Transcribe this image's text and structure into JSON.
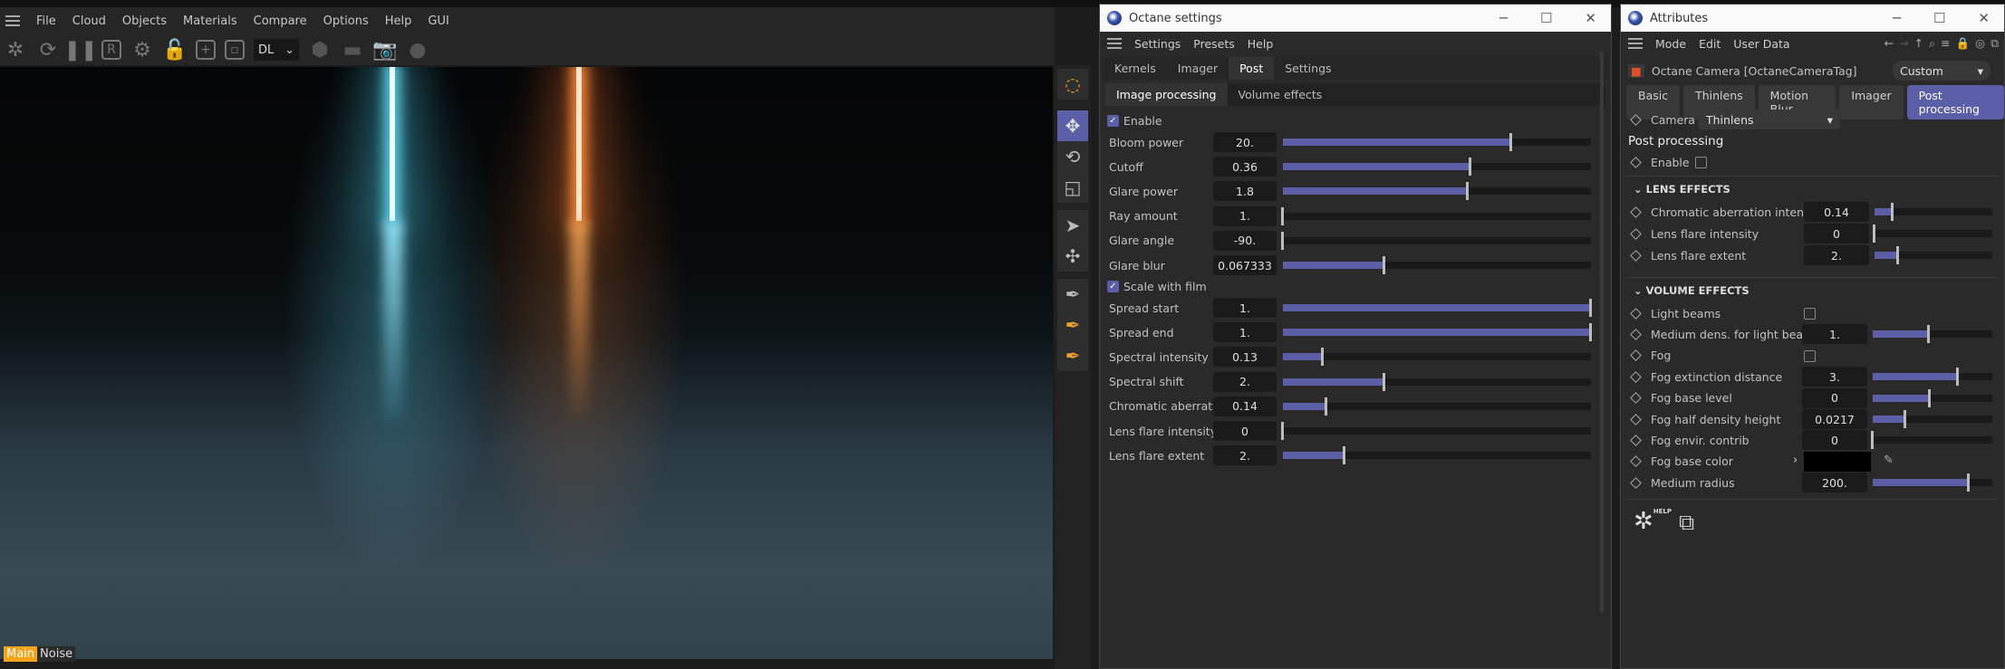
{
  "main_app": {
    "menu": [
      "File",
      "Cloud",
      "Objects",
      "Materials",
      "Compare",
      "Options",
      "Help",
      "GUI"
    ],
    "toolbar": {
      "icons": [
        "octane-logo-icon",
        "refresh-icon",
        "pause-icon",
        "render-region-icon",
        "settings-gear-icon",
        "lock-open-icon",
        "add-frame-icon",
        "frame-icon"
      ],
      "kernel_select": "DL",
      "kernel_arrow": "⌄"
    },
    "viewport_tabs": [
      "Main",
      "Noise"
    ],
    "colors": {
      "accent": "#f5a31a",
      "blue_light": "#5fd0e6",
      "orange_light": "#ff8a3a"
    }
  },
  "tool_column": {
    "icons": [
      "live-selection-icon",
      "move-icon",
      "rotate-icon",
      "scale-icon",
      "move-select-icon",
      "move-points-icon",
      "spline-pen-icon",
      "pen-point-icon",
      "pen-points-icon"
    ],
    "active": "move-icon"
  },
  "octane_settings": {
    "title": "Octane settings",
    "menu": [
      "Settings",
      "Presets",
      "Help"
    ],
    "tabs": [
      "Kernels",
      "Imager",
      "Post",
      "Settings"
    ],
    "active_tab": "Post",
    "subtabs": [
      "Image processing",
      "Volume effects"
    ],
    "active_subtab": "Image processing",
    "enable_label": "Enable",
    "enable_checked": true,
    "scale_with_film_label": "Scale with film",
    "scale_with_film_checked": true,
    "params_a": [
      {
        "label": "Bloom power",
        "value": "20.",
        "level": 0.74
      },
      {
        "label": "Cutoff",
        "value": "0.36",
        "level": 0.61
      },
      {
        "label": "Glare power",
        "value": "1.8",
        "level": 0.6
      },
      {
        "label": "Ray amount",
        "value": "1.",
        "level": 0
      },
      {
        "label": "Glare angle",
        "value": "-90.",
        "level": 0
      },
      {
        "label": "Glare blur",
        "value": "0.067333",
        "level": 0.33
      }
    ],
    "params_b": [
      {
        "label": "Spread start",
        "value": "1.",
        "level": 1
      },
      {
        "label": "Spread end",
        "value": "1.",
        "level": 1
      },
      {
        "label": "Spectral intensity",
        "value": "0.13",
        "level": 0.13
      },
      {
        "label": "Spectral shift",
        "value": "2.",
        "level": 0.33
      },
      {
        "label": "Chromatic aberrati...",
        "value": "0.14",
        "level": 0.14
      },
      {
        "label": "Lens flare intensity",
        "value": "0",
        "level": 0
      },
      {
        "label": "Lens flare extent",
        "value": "2.",
        "level": 0.2
      }
    ]
  },
  "attributes": {
    "title": "Attributes",
    "menu": [
      "Mode",
      "Edit",
      "User Data"
    ],
    "nav_icons": [
      "back-arrow-icon",
      "forward-arrow-icon",
      "up-arrow-icon",
      "search-icon",
      "filter-icon",
      "lock-icon",
      "target-icon",
      "new-window-icon"
    ],
    "object_name": "Octane Camera [OctaneCameraTag]",
    "preset": "Custom",
    "tabs": [
      "Basic",
      "Thinlens",
      "Motion Blur",
      "Imager",
      "Post processing"
    ],
    "active_tab": "Post processing",
    "camera_type_label": "Camera type",
    "camera_type": "Thinlens",
    "section_title": "Post processing",
    "enable_label": "Enable",
    "enable_checked": false,
    "lens_effects_title": "LENS EFFECTS",
    "lens_effects": [
      {
        "label": "Chromatic aberration intensity",
        "value": "0.14",
        "level": 0.15
      },
      {
        "label": "Lens flare intensity",
        "value": "0",
        "level": 0
      },
      {
        "label": "Lens flare extent",
        "value": "2.",
        "level": 0.2
      }
    ],
    "volume_effects_title": "VOLUME EFFECTS",
    "volume_effects": [
      {
        "label": "Light beams",
        "type": "checkbox",
        "checked": false
      },
      {
        "label": "Medium dens. for light beams",
        "value": "1.",
        "level": 0.47
      },
      {
        "label": "Fog",
        "type": "checkbox",
        "checked": false
      },
      {
        "label": "Fog extinction distance",
        "value": "3.",
        "level": 0.71
      },
      {
        "label": "Fog base level",
        "value": "0",
        "level": 0.48
      },
      {
        "label": "Fog half density height",
        "value": "0.0217",
        "level": 0.27
      },
      {
        "label": "Fog envir. contrib",
        "value": "0",
        "level": 0
      },
      {
        "label": "Fog base color",
        "type": "color",
        "color": "#000000"
      },
      {
        "label": "Medium radius",
        "value": "200.",
        "level": 0.8
      }
    ],
    "help_badge": "HELP"
  }
}
